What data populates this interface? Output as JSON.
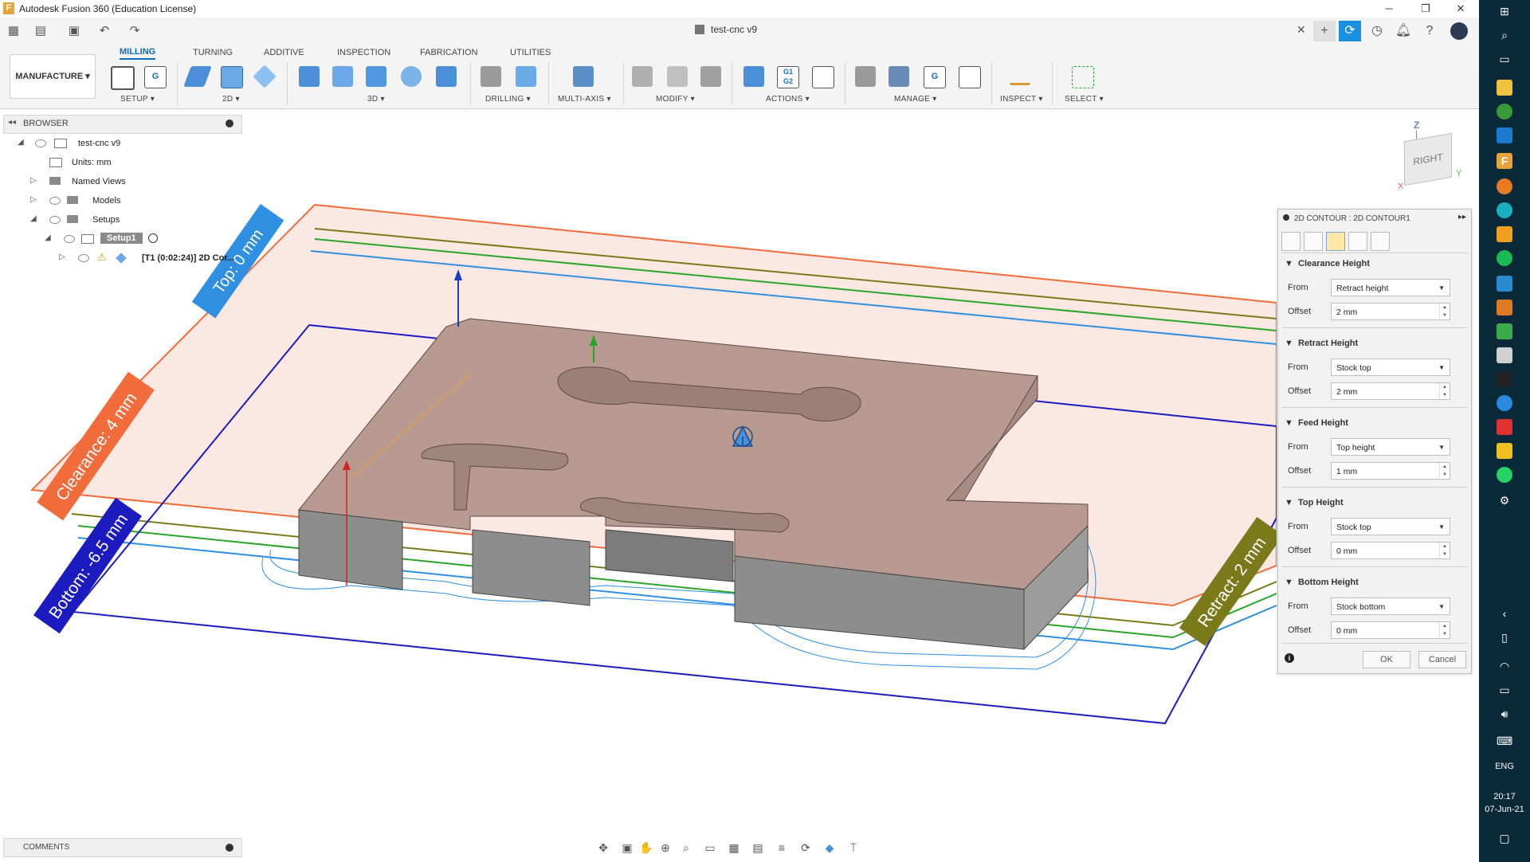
{
  "window": {
    "title": "Autodesk Fusion 360 (Education License)",
    "minimize": "─",
    "restore": "❐",
    "close": "✕"
  },
  "quickbar": {
    "doc_tab": "test-cnc v9",
    "doc_close": "✕"
  },
  "ribbon": {
    "workspace": "MANUFACTURE",
    "tabs": [
      "MILLING",
      "TURNING",
      "ADDITIVE",
      "INSPECTION",
      "FABRICATION",
      "UTILITIES"
    ],
    "groups": [
      "SETUP",
      "2D",
      "3D",
      "DRILLING",
      "MULTI-AXIS",
      "MODIFY",
      "ACTIONS",
      "MANAGE",
      "INSPECT",
      "SELECT"
    ]
  },
  "browser": {
    "title": "BROWSER",
    "items": {
      "root": "test-cnc v9",
      "units": "Units: mm",
      "named_views": "Named Views",
      "models": "Models",
      "setups": "Setups",
      "setup1": "Setup1",
      "operation": "[T1 (0:02:24)] 2D Cor..."
    }
  },
  "viewport_labels": {
    "top": "Top: 0 mm",
    "clearance": "Clearance: 4 mm",
    "bottom": "Bottom: -6.5 mm",
    "retract": "Retract: 2 mm"
  },
  "viewcube": {
    "face": "RIGHT",
    "z": "Z",
    "y": "Y",
    "x": "X"
  },
  "dialog": {
    "title": "2D CONTOUR : 2D CONTOUR1",
    "sections": [
      {
        "title": "Clearance Height",
        "from_label": "From",
        "from": "Retract height",
        "offset_label": "Offset",
        "offset": "2 mm"
      },
      {
        "title": "Retract Height",
        "from_label": "From",
        "from": "Stock top",
        "offset_label": "Offset",
        "offset": "2 mm"
      },
      {
        "title": "Feed Height",
        "from_label": "From",
        "from": "Top height",
        "offset_label": "Offset",
        "offset": "1 mm"
      },
      {
        "title": "Top Height",
        "from_label": "From",
        "from": "Stock top",
        "offset_label": "Offset",
        "offset": "0 mm"
      },
      {
        "title": "Bottom Height",
        "from_label": "From",
        "from": "Stock bottom",
        "offset_label": "Offset",
        "offset": "0 mm"
      }
    ],
    "ok": "OK",
    "cancel": "Cancel"
  },
  "comments": {
    "title": "COMMENTS"
  },
  "taskbar": {
    "time": "20:17",
    "date": "07-Jun-21",
    "lang": "ENG"
  },
  "colors": {
    "accent": "#0a6fc2",
    "clearance_plane": "#f26b3a",
    "retract_plane": "#7a7a1a",
    "feed_plane": "#2aa52a",
    "top_plane": "#2f8fe0",
    "bottom_plane": "#1b1bc0",
    "stock": "#b89a90"
  }
}
